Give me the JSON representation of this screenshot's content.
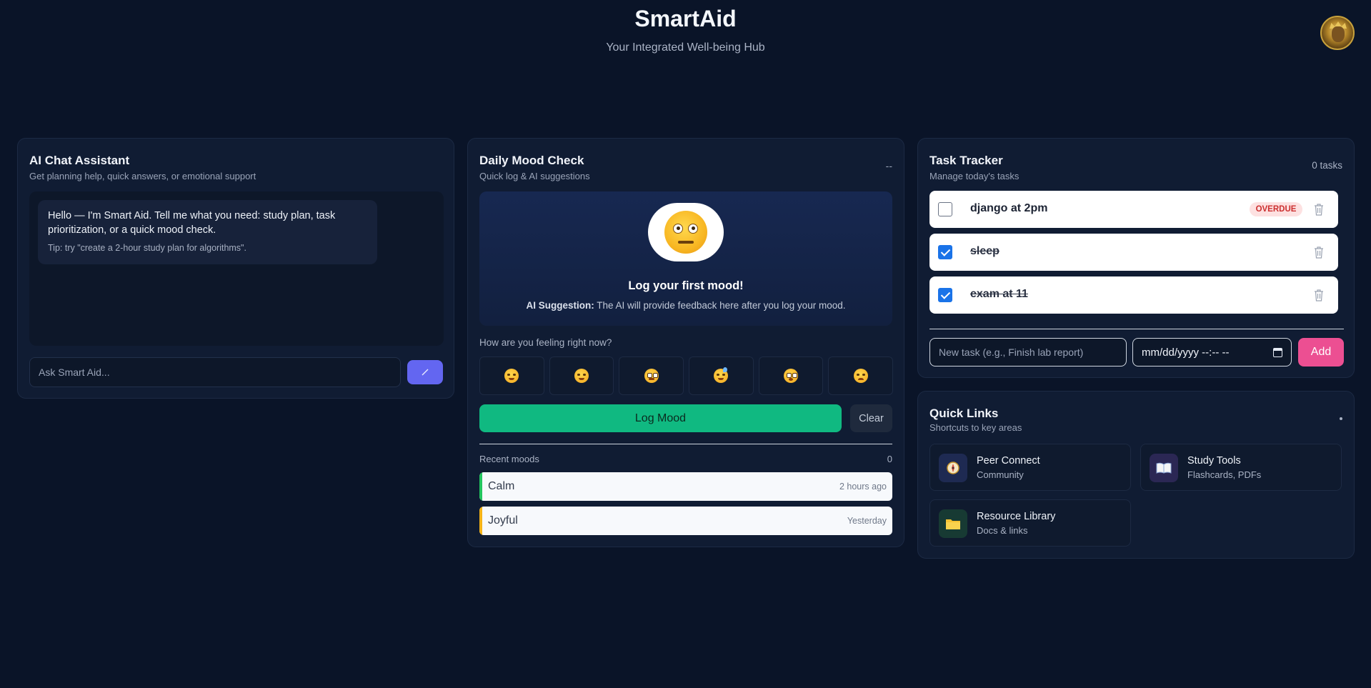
{
  "header": {
    "title": "SmartAid",
    "subtitle": "Your Integrated Well-being Hub",
    "avatar_icon": "user-avatar-icon"
  },
  "chat": {
    "title": "AI Chat Assistant",
    "subtitle": "Get planning help, quick answers, or emotional support",
    "messages": [
      {
        "sender": "assistant",
        "text": "Hello — I'm Smart Aid. Tell me what you need: study plan, task prioritization, or a quick mood check.",
        "tip": "Tip: try \"create a 2-hour study plan for algorithms\"."
      }
    ],
    "input_placeholder": "Ask Smart Aid...",
    "send_icon": "send-icon",
    "accent_color": "#6366f1"
  },
  "mood": {
    "title": "Daily Mood Check",
    "subtitle": "Quick log & AI suggestions",
    "counter": "--",
    "hero_title": "Log your first mood!",
    "suggestion_label": "AI Suggestion:",
    "suggestion_text": " The AI will provide feedback here after you log your mood.",
    "question": "How are you feeling right now?",
    "options": [
      "happy",
      "content",
      "neutral",
      "tired",
      "anxious",
      "sad"
    ],
    "log_label": "Log Mood",
    "clear_label": "Clear",
    "recent_label": "Recent moods",
    "recent_count": "0",
    "recent": [
      {
        "name": "Calm",
        "time": "2 hours ago",
        "color": "#22c55e"
      },
      {
        "name": "Joyful",
        "time": "Yesterday",
        "color": "#f5b316"
      }
    ],
    "log_color": "#10b981"
  },
  "tasks": {
    "title": "Task Tracker",
    "subtitle": "Manage today's tasks",
    "count": "0 tasks",
    "items": [
      {
        "text": "django at 2pm",
        "done": false,
        "badge": "OVERDUE"
      },
      {
        "text": "sleep",
        "done": true,
        "badge": ""
      },
      {
        "text": "exam at 11",
        "done": true,
        "badge": ""
      }
    ],
    "input_placeholder": "New task (e.g., Finish lab report)",
    "date_placeholder": "mm/dd/yyyy --:-- --",
    "add_label": "Add",
    "add_color": "#ec4f92"
  },
  "links": {
    "title": "Quick Links",
    "subtitle": "Shortcuts to key areas",
    "items": [
      {
        "title": "Peer Connect",
        "sub": "Community",
        "icon": "compass-icon",
        "icon_bg": "#1e2a52"
      },
      {
        "title": "Study Tools",
        "sub": "Flashcards, PDFs",
        "icon": "book-icon",
        "icon_bg": "#2b2754"
      },
      {
        "title": "Resource Library",
        "sub": "Docs & links",
        "icon": "folder-icon",
        "icon_bg": "#173a33"
      }
    ]
  }
}
